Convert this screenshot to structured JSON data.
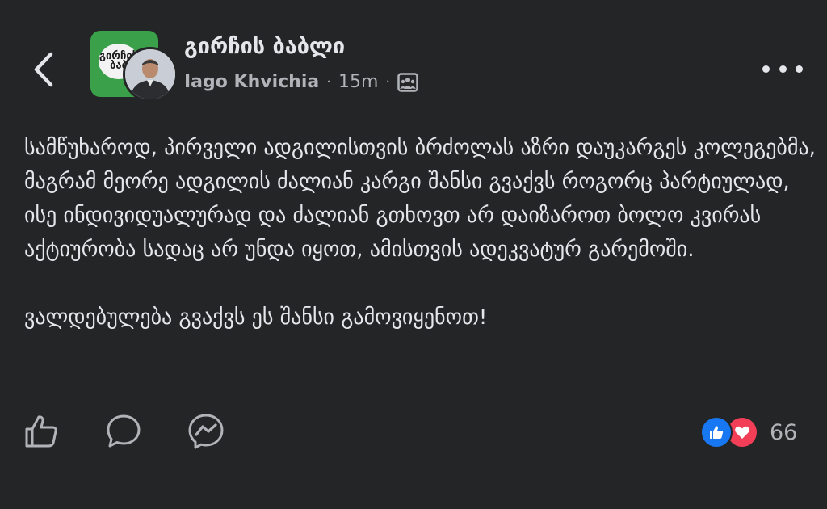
{
  "header": {
    "group_name": "გირჩის ბაბლი",
    "group_avatar_text": "გირჩის ბაბ",
    "author": "Iago Khvichia",
    "separator": "·",
    "time": "15m",
    "icons": {
      "back": "chevron-left-icon",
      "audience": "group-audience-icon",
      "more": "more-dots-icon"
    }
  },
  "post": {
    "paragraphs": [
      "სამწუხაროდ, პირველი ადგილისთვის ბრძოლას აზრი დაუკარგეს კოლეგებმა, მაგრამ მეორე ადგილის ძალიან კარგი შანსი გვაქვს როგორც პარტიულად, ისე ინდივიდუალურად და ძალიან გთხოვთ არ დაიზაროთ ბოლო კვირას აქტიურობა სადაც არ უნდა იყოთ, ამისთვის ადეკვატურ გარემოში.",
      "ვალდებულება გვაქვს ეს შანსი გამოვიყენოთ!"
    ]
  },
  "footer": {
    "icons": {
      "like": "thumbs-up-icon",
      "comment": "comment-bubble-icon",
      "share": "messenger-icon"
    },
    "reactions": [
      "like",
      "love"
    ],
    "reaction_count": "66"
  },
  "colors": {
    "background": "#242526",
    "text": "#e4e6eb",
    "muted": "#b0b3b8",
    "like": "#1877f2",
    "love": "#f33e58",
    "group_green": "#3aa04a"
  }
}
